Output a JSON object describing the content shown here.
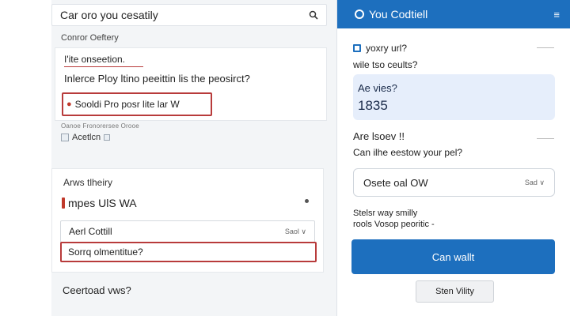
{
  "search": {
    "value": "Car oro you cesatily"
  },
  "section_label": "Conror Oeftery",
  "card1": {
    "line1": "I'ite onseetion.",
    "line2": "Inlerce Ploy ltino peeittin lis the peosirct?",
    "highlight": "Sooldi Pro posr lite lar W"
  },
  "mini_label": "Oanoe Fronorersee Orooe",
  "checkbox_label": "Acetlcn",
  "card2": {
    "title": "Arws tlheiry",
    "heading": "mpes UlS WA",
    "select_value": "Aerl Cottill",
    "select_hint": "Saol",
    "error_value": "Sorrq olmentitue?"
  },
  "bottom_question": "Ceertoad vws?",
  "right": {
    "header_title": "You Codtiell",
    "menu_glyph": "≡",
    "q1": "yoxry url?",
    "q1b": "wile tso ceults?",
    "value_label": "Ae vies?",
    "value_number": "1835",
    "q2": "Are lsoev !!",
    "q2b": "Can ilhe eestow your pel?",
    "select_value": "Osete oal OW",
    "select_hint": "Sad",
    "note1": "Stelsr way smilly",
    "note2": "rools Vosop peoritic -",
    "primary_button": "Can wallt",
    "secondary_button": "Sten Vility"
  },
  "colors": {
    "accent": "#1d6fbe",
    "error": "#b83b3b",
    "value_bg": "#e6eefb"
  }
}
